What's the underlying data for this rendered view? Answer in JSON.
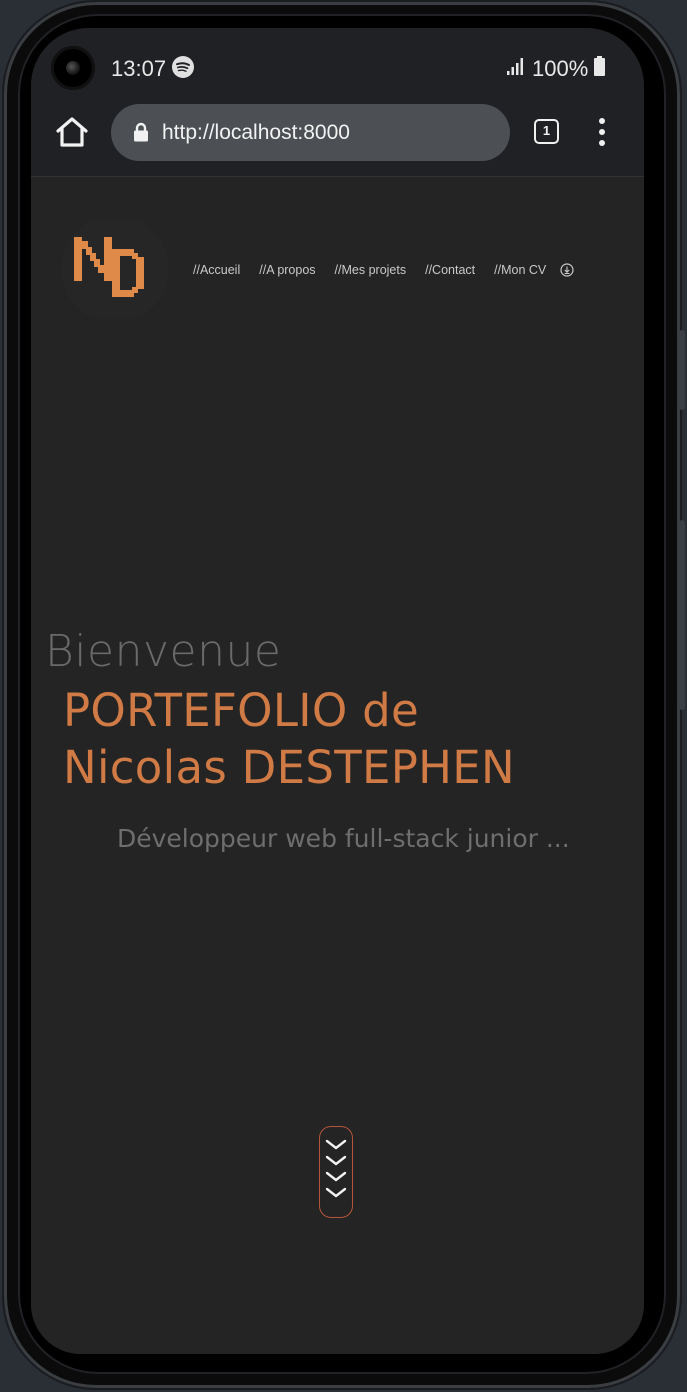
{
  "status_bar": {
    "time": "13:07",
    "battery": "100%",
    "icons": [
      "spotify-icon",
      "signal-icon",
      "battery-icon",
      "camera"
    ]
  },
  "browser": {
    "url": "http://localhost:8000",
    "tab_count": "1",
    "icons": [
      "home-icon",
      "lock-icon",
      "tab-switcher",
      "more-vert-icon"
    ]
  },
  "site": {
    "logo_text": "ND",
    "nav": [
      "//Accueil",
      "//A propos",
      "//Mes projets",
      "//Contact",
      "//Mon CV"
    ],
    "cv_icon": "download-icon",
    "hero": {
      "greeting": "Bienvenue",
      "title_line1": "PORTEFOLIO de",
      "title_line2": "Nicolas DESTEPHEN",
      "subtitle": "Développeur web full-stack junior ..."
    },
    "scroll_icon": "chevrons-down-icon"
  },
  "colors": {
    "accent": "#d07a45",
    "page_bg": "#242424",
    "chrome_bg": "#202124",
    "url_bar_bg": "#4c5055",
    "scroll_border": "#b5543d"
  }
}
